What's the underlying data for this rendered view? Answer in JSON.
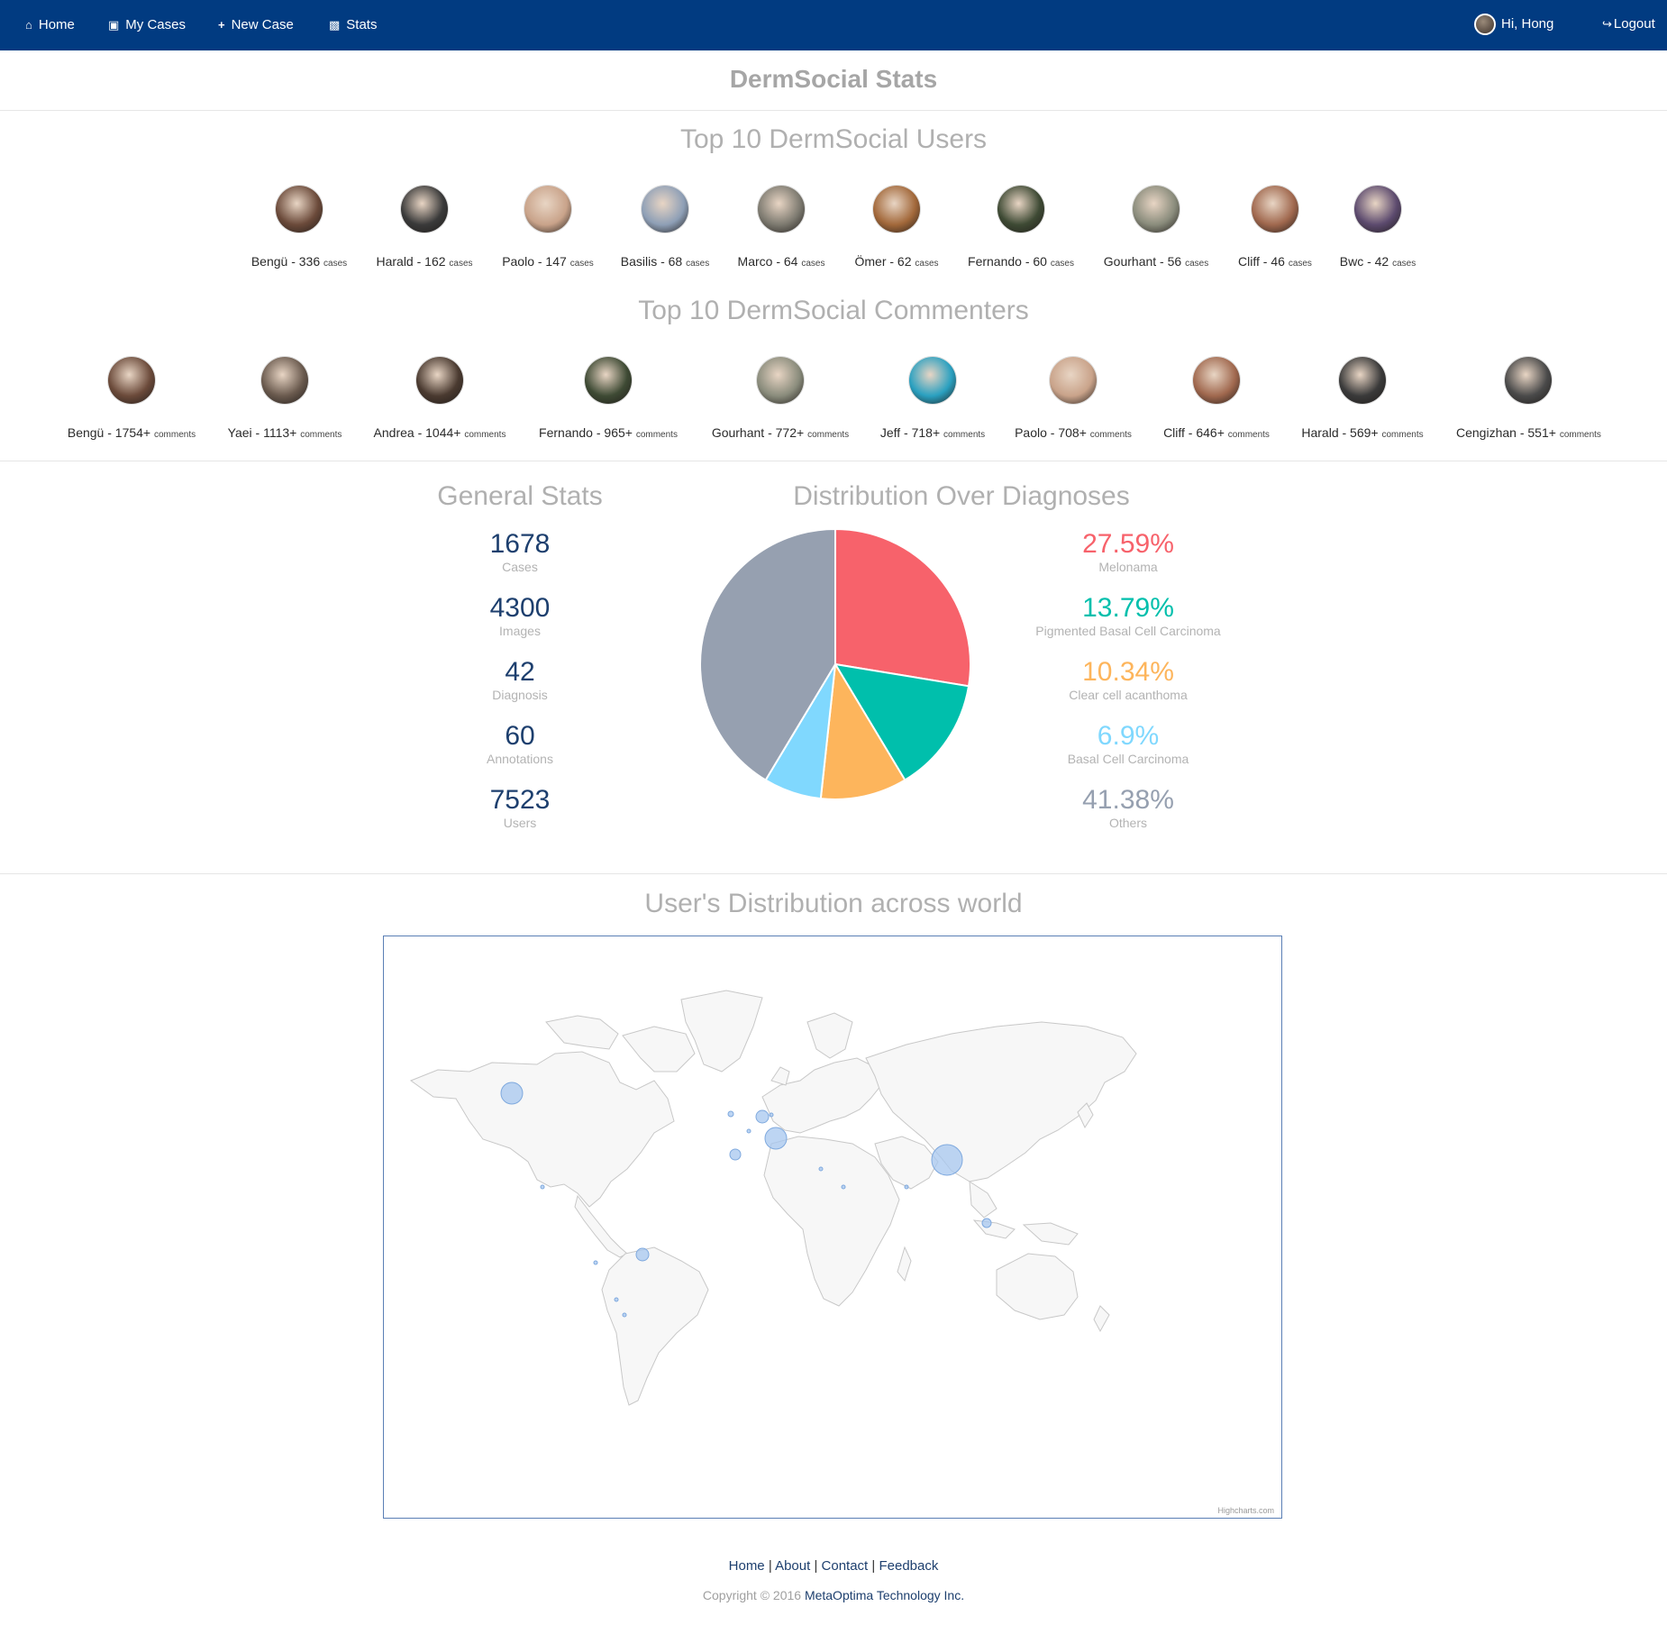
{
  "nav": {
    "home": "Home",
    "my_cases": "My Cases",
    "new_case": "New Case",
    "stats": "Stats",
    "greeting": "Hi, Hong",
    "logout": "Logout"
  },
  "page_title": "DermSocial Stats",
  "top_users": {
    "title": "Top 10 DermSocial Users",
    "unit": "cases",
    "items": [
      {
        "label": "Bengü - 336",
        "color": "#6b4a3a"
      },
      {
        "label": "Harald - 162",
        "color": "#3a3a3a"
      },
      {
        "label": "Paolo - 147",
        "color": "#c9a38a"
      },
      {
        "label": "Basilis - 68",
        "color": "#8e9fb6"
      },
      {
        "label": "Marco - 64",
        "color": "#7d7a70"
      },
      {
        "label": "Ömer - 62",
        "color": "#a2683a"
      },
      {
        "label": "Fernando - 60",
        "color": "#3e4a34"
      },
      {
        "label": "Gourhant - 56",
        "color": "#8a8c7c"
      },
      {
        "label": "Cliff - 46",
        "color": "#a0684e"
      },
      {
        "label": "Bwc - 42",
        "color": "#5c4a6e"
      }
    ]
  },
  "top_commenters": {
    "title": "Top 10 DermSocial Commenters",
    "unit": "comments",
    "items": [
      {
        "label": "Bengü - 1754+",
        "color": "#6b4a3a"
      },
      {
        "label": "Yaei - 1113+",
        "color": "#6a5a4e"
      },
      {
        "label": "Andrea - 1044+",
        "color": "#4a3a30"
      },
      {
        "label": "Fernando - 965+",
        "color": "#3e4a34"
      },
      {
        "label": "Gourhant - 772+",
        "color": "#8a8c7c"
      },
      {
        "label": "Jeff - 718+",
        "color": "#2aa0c0"
      },
      {
        "label": "Paolo - 708+",
        "color": "#c9a38a"
      },
      {
        "label": "Cliff - 646+",
        "color": "#a0684e"
      },
      {
        "label": "Harald - 569+",
        "color": "#3a3a3a"
      },
      {
        "label": "Cengizhan - 551+",
        "color": "#4a4a4a"
      }
    ]
  },
  "general_stats": {
    "title": "General Stats",
    "items": [
      {
        "value": "1678",
        "label": "Cases"
      },
      {
        "value": "4300",
        "label": "Images"
      },
      {
        "value": "42",
        "label": "Diagnosis"
      },
      {
        "value": "60",
        "label": "Annotations"
      },
      {
        "value": "7523",
        "label": "Users"
      }
    ]
  },
  "distribution": {
    "title": "Distribution Over Diagnoses",
    "items": [
      {
        "value": "27.59%",
        "label": "Melonama",
        "color": "#f7626b"
      },
      {
        "value": "13.79%",
        "label": "Pigmented Basal Cell Carcinoma",
        "color": "#00bfac"
      },
      {
        "value": "10.34%",
        "label": "Clear cell acanthoma",
        "color": "#fdb55c"
      },
      {
        "value": "6.9%",
        "label": "Basal Cell Carcinoma",
        "color": "#80d8fe"
      },
      {
        "value": "41.38%",
        "label": "Others",
        "color": "#96a0b0"
      }
    ]
  },
  "chart_data": {
    "type": "pie",
    "categories": [
      "Melonama",
      "Pigmented Basal Cell Carcinoma",
      "Clear cell acanthoma",
      "Basal Cell Carcinoma",
      "Others"
    ],
    "values": [
      27.59,
      13.79,
      10.34,
      6.9,
      41.38
    ],
    "colors": [
      "#f7626b",
      "#00bfac",
      "#fdb55c",
      "#80d8fe",
      "#96a0b0"
    ]
  },
  "world_map": {
    "title": "User's Distribution across world",
    "credit": "Highcharts.com"
  },
  "footer": {
    "home": "Home",
    "about": "About",
    "contact": "Contact",
    "feedback": "Feedback",
    "copyright_prefix": "Copyright © 2016",
    "company": "MetaOptima Technology Inc."
  }
}
